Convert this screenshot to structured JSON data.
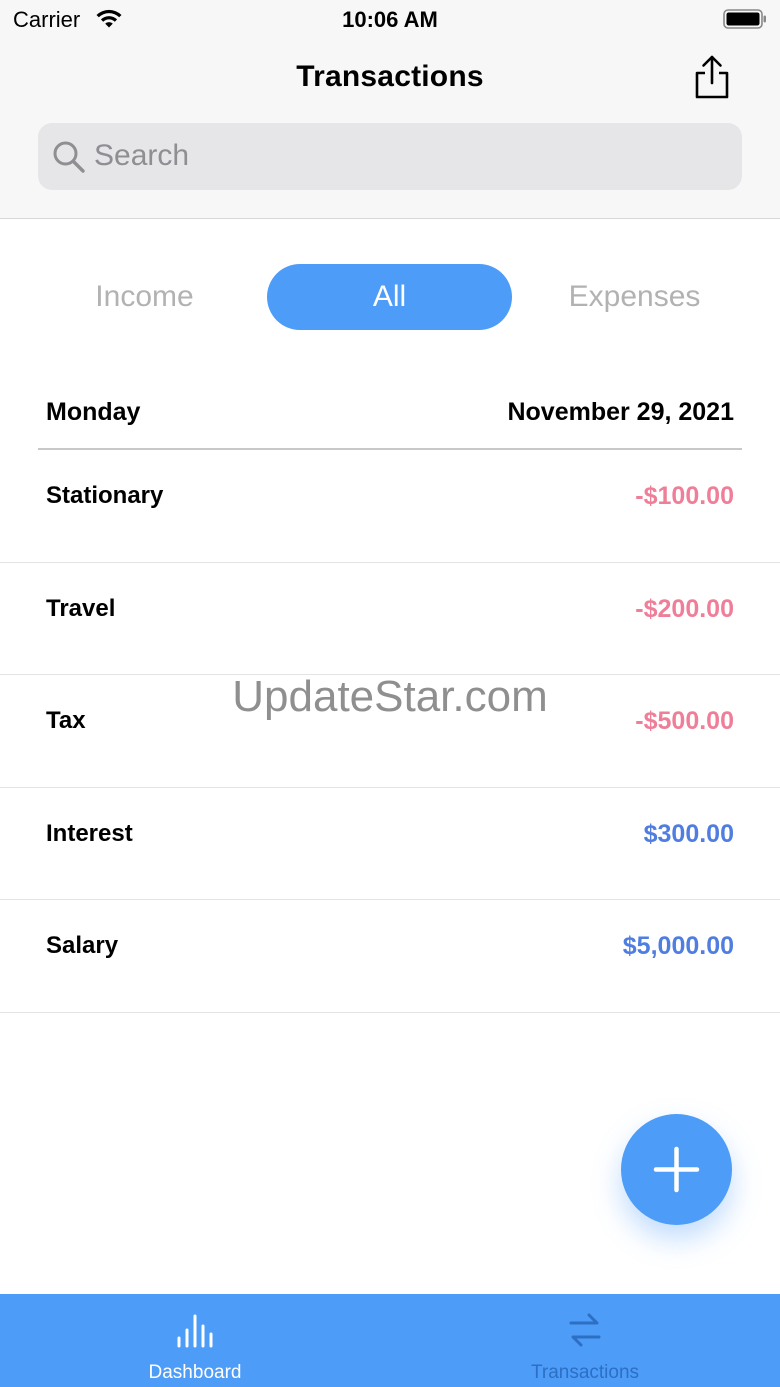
{
  "status_bar": {
    "carrier": "Carrier",
    "time": "10:06 AM",
    "icons": [
      "wifi-icon",
      "battery-icon"
    ]
  },
  "header": {
    "title": "Transactions",
    "share_icon": "share-icon"
  },
  "search": {
    "placeholder": "Search",
    "value": "",
    "icon": "search-icon"
  },
  "filter": {
    "options": [
      "Income",
      "All",
      "Expenses"
    ],
    "selected": "All"
  },
  "section": {
    "day": "Monday",
    "date": "November 29, 2021"
  },
  "transactions": [
    {
      "name": "Stationary",
      "amount": "-$100.00",
      "type": "expense"
    },
    {
      "name": "Travel",
      "amount": "-$200.00",
      "type": "expense"
    },
    {
      "name": "Tax",
      "amount": "-$500.00",
      "type": "expense"
    },
    {
      "name": "Interest",
      "amount": "$300.00",
      "type": "income"
    },
    {
      "name": "Salary",
      "amount": "$5,000.00",
      "type": "income"
    }
  ],
  "watermark": "UpdateStar.com",
  "fab": {
    "icon": "plus-icon"
  },
  "tab_bar": {
    "tabs": [
      {
        "label": "Dashboard",
        "icon": "bar-chart-icon",
        "active": true
      },
      {
        "label": "Transactions",
        "icon": "swap-arrows-icon",
        "active": false
      }
    ]
  },
  "colors": {
    "accent": "#4d9cf8",
    "expense": "#ef7f98",
    "income": "#4f7de0",
    "inactive_segment": "#b2b2b2",
    "inactive_tab": "#2c6fc4"
  }
}
